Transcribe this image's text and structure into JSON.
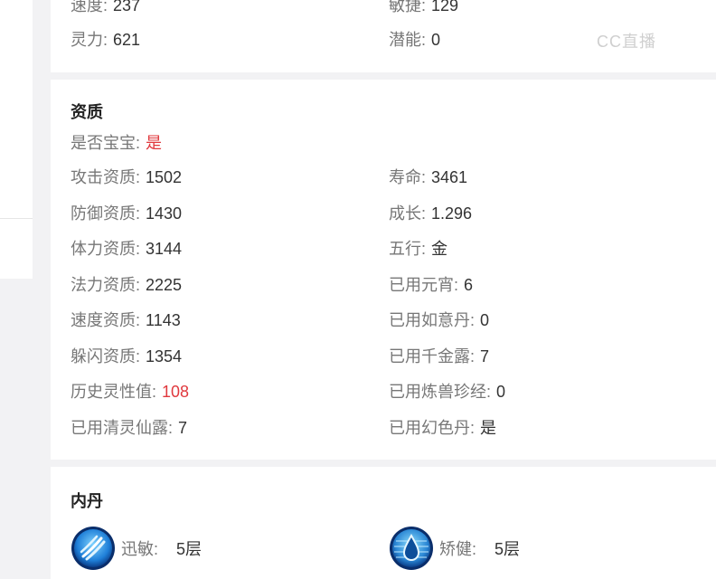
{
  "top_attributes": [
    {
      "label": "速度:",
      "value": "237"
    },
    {
      "label": "敏捷:",
      "value": "129"
    },
    {
      "label": "灵力:",
      "value": "621"
    },
    {
      "label": "潜能:",
      "value": "0"
    }
  ],
  "watermark": "CC直播",
  "aptitude": {
    "title": "资质",
    "is_baby_label": "是否宝宝:",
    "is_baby_value": "是",
    "left": [
      {
        "label": "攻击资质:",
        "value": "1502"
      },
      {
        "label": "防御资质:",
        "value": "1430"
      },
      {
        "label": "体力资质:",
        "value": "3144"
      },
      {
        "label": "法力资质:",
        "value": "2225"
      },
      {
        "label": "速度资质:",
        "value": "1143"
      },
      {
        "label": "躲闪资质:",
        "value": "1354"
      },
      {
        "label": "历史灵性值:",
        "value": "108"
      },
      {
        "label": "已用清灵仙露:",
        "value": "7"
      }
    ],
    "right": [
      {
        "label": "寿命:",
        "value": "3461"
      },
      {
        "label": "成长:",
        "value": "1.296"
      },
      {
        "label": "五行:",
        "value": "金"
      },
      {
        "label": "已用元宵:",
        "value": "6"
      },
      {
        "label": "已用如意丹:",
        "value": "0"
      },
      {
        "label": "已用千金露:",
        "value": "7"
      },
      {
        "label": "已用炼兽珍经:",
        "value": "0"
      },
      {
        "label": "已用幻色丹:",
        "value": "是"
      }
    ]
  },
  "neidan": {
    "title": "内丹",
    "items": [
      {
        "name": "迅敏:",
        "level": "5层",
        "icon": "swift-claw-icon"
      },
      {
        "name": "矫健:",
        "level": "5层",
        "icon": "water-drop-icon"
      }
    ]
  },
  "colors": {
    "highlight": "#e0393e",
    "label": "#777777",
    "value": "#333333"
  }
}
